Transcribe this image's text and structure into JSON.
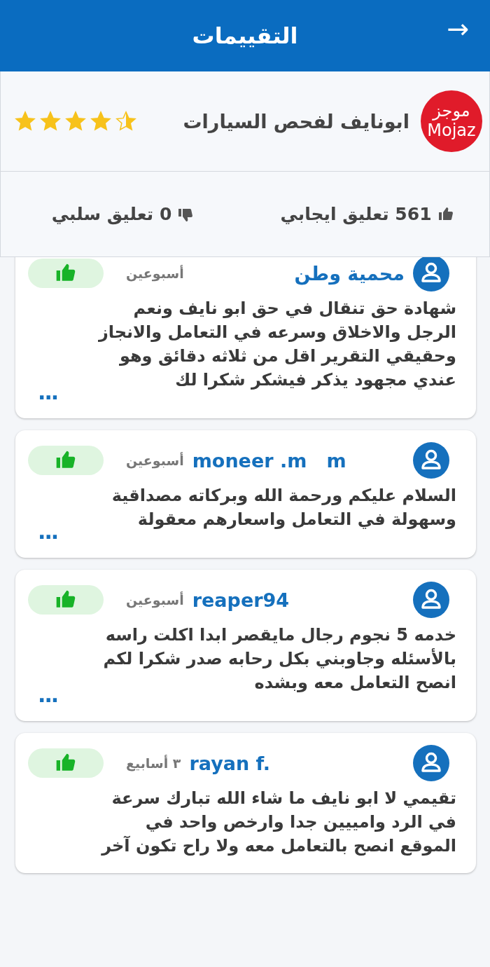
{
  "header": {
    "title": "التقييمات",
    "back_icon": "→"
  },
  "business": {
    "logo_lines": [
      "موجز",
      "Mojaz"
    ],
    "name": "ابونايف لفحص السيارات",
    "stars": 4.5
  },
  "stats": {
    "positive": "561 تعليق ايجابي",
    "negative": "0 تعليق سلبي"
  },
  "reviews": [
    {
      "name": "محمية وطن",
      "date": "أسبوعين",
      "text": "شهادة حق تنقال في حق ابو نايف ونعم الرجل والاخلاق وسرعه في التعامل والانجاز وحقيقي التقرير اقل من ثلاثه دقائق وهو عندي مجهود يذكر فيشكر شكرا لك",
      "more": "..."
    },
    {
      "name": "moneer .m   m",
      "date": "أسبوعين",
      "text": "السلام عليكم ورحمة الله وبركاته مصداقية وسهولة في التعامل واسعارهم معقولة",
      "more": "..."
    },
    {
      "name": "reaper94",
      "date": "أسبوعين",
      "text": "خدمه 5 نجوم رجال مايقصر ابدا اكلت راسه بالأسئله وجاوبني بكل رحابه صدر شكرا لكم انصح التعامل معه وبشده",
      "more": "..."
    },
    {
      "name": "rayan f.",
      "date": "٣ أسابيع",
      "text": "تقيمي لا ابو نايف ما شاء الله تبارك سرعة في الرد وامييين جدا وارخص واحد في الموقع انصح بالتعامل معه ولا راح تكون آخر"
    }
  ]
}
